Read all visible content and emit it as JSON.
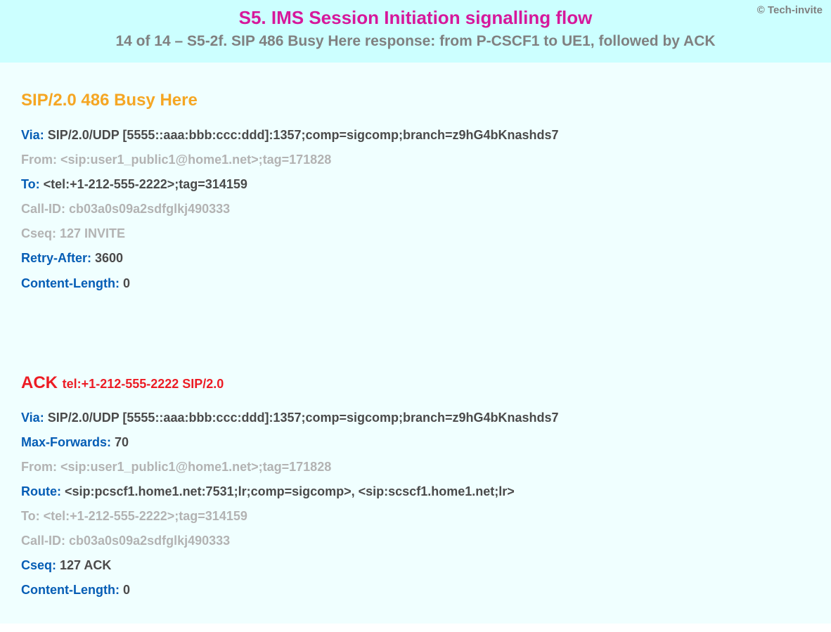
{
  "copyright": "© Tech-invite",
  "header": {
    "title": "S5. IMS Session Initiation signalling flow",
    "subtitle": "14 of 14 – S5-2f. SIP 486 Busy Here response: from P-CSCF1 to UE1, followed by ACK"
  },
  "response": {
    "title": "SIP/2.0 486 Busy Here",
    "via_label": "Via:",
    "via_value": " SIP/2.0/UDP [5555::aaa:bbb:ccc:ddd]:1357;comp=sigcomp;branch=z9hG4bKnashds7",
    "from_label": "From:",
    "from_value": " <sip:user1_public1@home1.net>;tag=171828",
    "to_label": "To:",
    "to_value": " <tel:+1-212-555-2222>;tag=314159",
    "callid_label": "Call-ID:",
    "callid_value": " cb03a0s09a2sdfglkj490333",
    "cseq_label": "Cseq:",
    "cseq_value": " 127 INVITE",
    "retry_label": "Retry-After:",
    "retry_value": " 3600",
    "clen_label": "Content-Length:",
    "clen_value": " 0"
  },
  "ack": {
    "title_main": "ACK ",
    "title_rest": "tel:+1-212-555-2222 SIP/2.0",
    "via_label": "Via:",
    "via_value": " SIP/2.0/UDP [5555::aaa:bbb:ccc:ddd]:1357;comp=sigcomp;branch=z9hG4bKnashds7",
    "maxf_label": "Max-Forwards:",
    "maxf_value": " 70",
    "from_label": "From:",
    "from_value": " <sip:user1_public1@home1.net>;tag=171828",
    "route_label": "Route:",
    "route_value": " <sip:pcscf1.home1.net:7531;lr;comp=sigcomp>, <sip:scscf1.home1.net;lr>",
    "to_label": "To:",
    "to_value": " <tel:+1-212-555-2222>;tag=314159",
    "callid_label": "Call-ID:",
    "callid_value": " cb03a0s09a2sdfglkj490333",
    "cseq_label": "Cseq:",
    "cseq_value": " 127 ACK",
    "clen_label": "Content-Length:",
    "clen_value": " 0"
  }
}
